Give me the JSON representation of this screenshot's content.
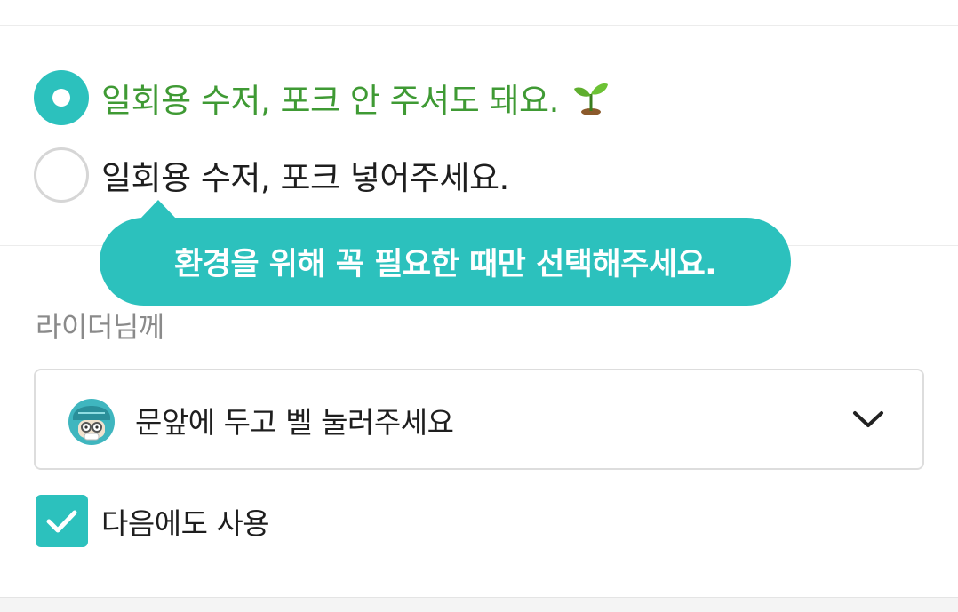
{
  "cutlery_options": {
    "option_no_cutlery": {
      "label": "일회용 수저, 포크 안 주셔도 돼요.",
      "selected": true,
      "icon": "sprout-icon"
    },
    "option_include_cutlery": {
      "label": "일회용 수저, 포크 넣어주세요.",
      "selected": false
    }
  },
  "tooltip": {
    "text": "환경을 위해 꼭 필요한 때만 선택해주세요."
  },
  "rider_request": {
    "section_label": "라이더님께",
    "selected_value": "문앞에 두고 벨 눌러주세요",
    "avatar_icon": "rider-avatar-icon",
    "dropdown_icon": "chevron-down-icon"
  },
  "remember_option": {
    "label": "다음에도 사용",
    "checked": true
  },
  "colors": {
    "accent": "#2cc1bd",
    "selected_text": "#3f9a34",
    "section_label": "#8a8a8a",
    "text": "#1e1e1e"
  }
}
